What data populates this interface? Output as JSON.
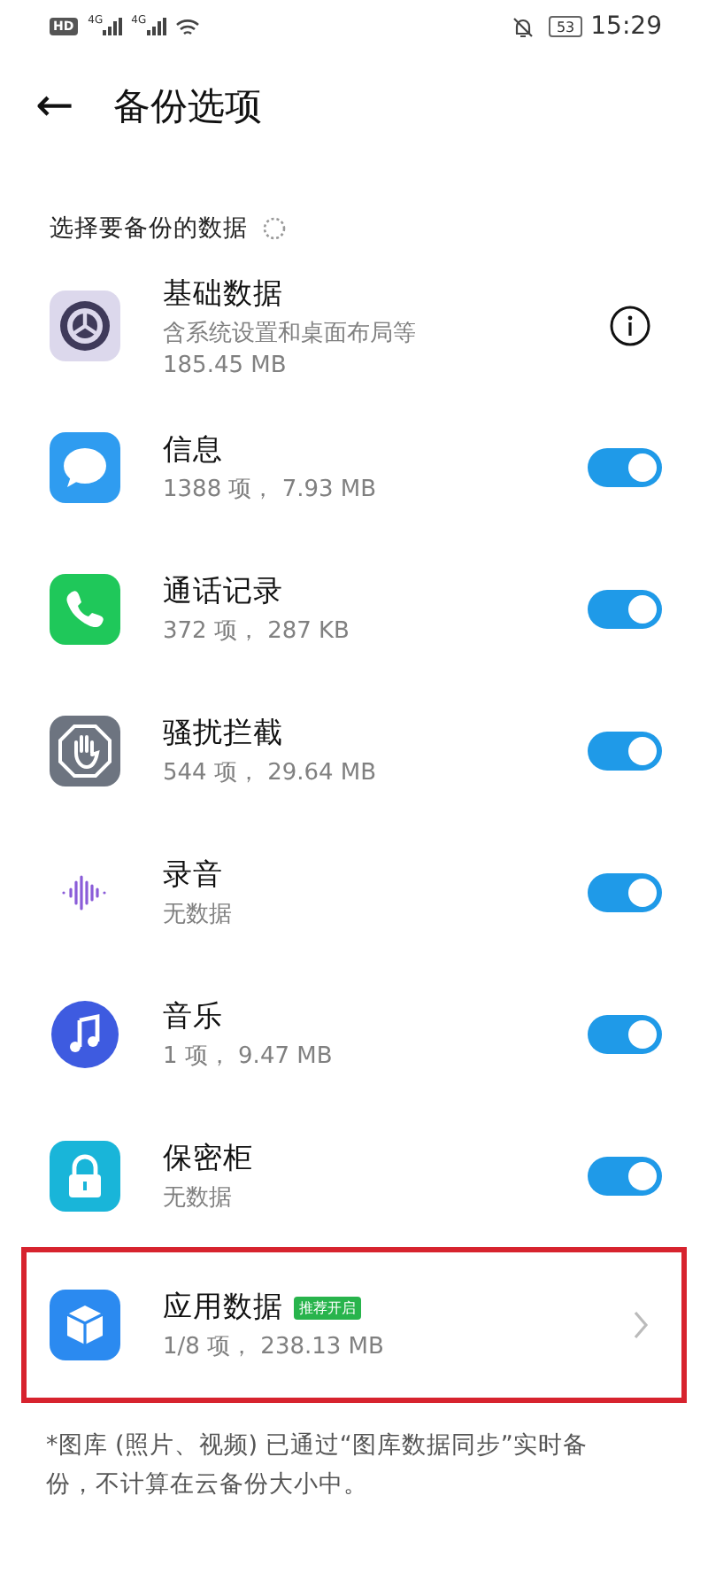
{
  "status_bar": {
    "hd": "HD",
    "networks": [
      "4G",
      "4G"
    ],
    "battery": "53",
    "time": "15:29"
  },
  "header": {
    "back": "←",
    "title": "备份选项"
  },
  "section": {
    "title": "选择要备份的数据",
    "loading": true
  },
  "items": [
    {
      "kind": "info",
      "title": "基础数据",
      "details": [
        "含系统设置和桌面布局等",
        "185.45 MB"
      ],
      "highlighted": false
    },
    {
      "kind": "toggle",
      "title": "信息",
      "details": [
        "1388 项， 7.93 MB"
      ],
      "on": true,
      "highlighted": false
    },
    {
      "kind": "toggle",
      "title": "通话记录",
      "details": [
        "372 项， 287 KB"
      ],
      "on": true,
      "highlighted": false
    },
    {
      "kind": "toggle",
      "title": "骚扰拦截",
      "details": [
        "544 项， 29.64 MB"
      ],
      "on": true,
      "highlighted": false
    },
    {
      "kind": "toggle",
      "title": "录音",
      "details": [
        "无数据"
      ],
      "on": true,
      "highlighted": false
    },
    {
      "kind": "toggle",
      "title": "音乐",
      "details": [
        "1 项， 9.47 MB"
      ],
      "on": true,
      "highlighted": false
    },
    {
      "kind": "toggle",
      "title": "保密柜",
      "details": [
        "无数据"
      ],
      "on": true,
      "highlighted": false
    },
    {
      "kind": "link",
      "title": "应用数据",
      "badge": "推荐开启",
      "details": [
        "1/8 项， 238.13 MB"
      ],
      "highlighted": true
    }
  ],
  "footnote": "*图库 (照片、视频) 已通过“图库数据同步”实时备份，不计算在云备份大小中。"
}
